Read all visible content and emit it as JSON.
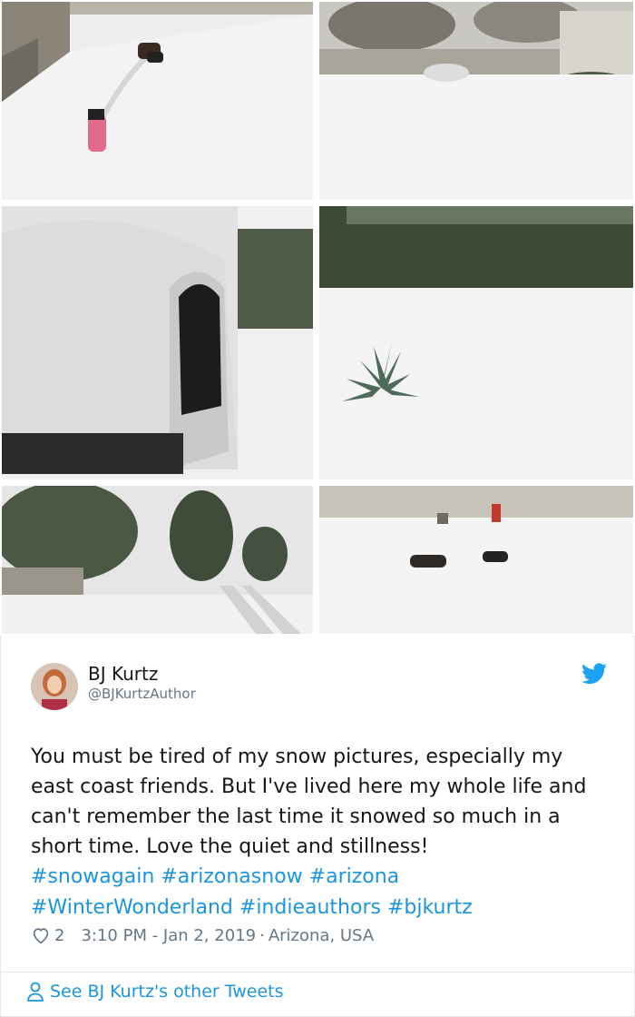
{
  "photos": [
    {
      "alt": "snow-yard-dogs-path-icon"
    },
    {
      "alt": "snow-backyard-icon"
    },
    {
      "alt": "snow-mailbox-icon"
    },
    {
      "alt": "snow-agave-icon"
    },
    {
      "alt": "snow-street-icon"
    },
    {
      "alt": "snow-dogs-yard-icon"
    }
  ],
  "tweet": {
    "display_name": "BJ Kurtz",
    "handle": "@BJKurtzAuthor",
    "text": "You must be tired of my snow pictures, especially my east coast friends. But I've lived here my whole life and can't remember the last time it snowed so much in a short time. Love the quiet and stillness!",
    "hashtags": [
      "#snowagain",
      "#arizonasnow",
      "#arizona",
      "#WinterWonderland",
      "#indieauthors",
      "#bjkurtz"
    ],
    "like_count": "2",
    "timestamp": "3:10 PM - Jan 2, 2019",
    "separator": "·",
    "location": "Arizona, USA",
    "see_more": "See BJ Kurtz's other Tweets"
  },
  "colors": {
    "link": "#1b95e0",
    "secondary_text": "#657786",
    "twitter_blue": "#1da1f2"
  },
  "icons": {
    "brand": "twitter-bird-icon",
    "like": "heart-icon",
    "profile": "person-icon"
  }
}
